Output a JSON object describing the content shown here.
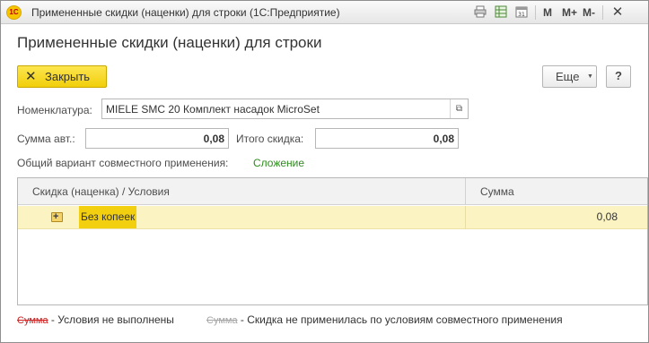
{
  "window": {
    "title": "Примененные скидки (наценки) для строки  (1С:Предприятие)",
    "logo_text": "1С",
    "controls": {
      "m": "M",
      "m_plus": "M+",
      "m_minus": "M-",
      "close": "✕"
    }
  },
  "page": {
    "title": "Примененные скидки (наценки) для строки"
  },
  "toolbar": {
    "close_label": "Закрыть",
    "more_label": "Еще",
    "help_label": "?"
  },
  "form": {
    "nomenclature_label": "Номенклатура:",
    "nomenclature_value": "MIELE SMC 20 Комплект насадок MicroSet",
    "sum_auto_label": "Сумма авт.:",
    "sum_auto_value": "0,08",
    "total_discount_label": "Итого скидка:",
    "total_discount_value": "0,08",
    "combined_label": "Общий вариант совместного применения:",
    "combined_value": "Сложение"
  },
  "table": {
    "columns": [
      "Скидка (наценка) / Условия",
      "Сумма"
    ],
    "rows": [
      {
        "name": "Без копеек",
        "sum": "0,08"
      }
    ]
  },
  "legend": {
    "red_sample": "Сумма",
    "red_text": "- Условия не выполнены",
    "gray_sample": "Сумма",
    "gray_text": "- Скидка не применилась по условиям совместного применения"
  },
  "colors": {
    "accent_yellow": "#f1cf0a",
    "row_highlight": "#fbf3c2",
    "link_green": "#2e8b1f",
    "strike_red": "#d02020"
  }
}
